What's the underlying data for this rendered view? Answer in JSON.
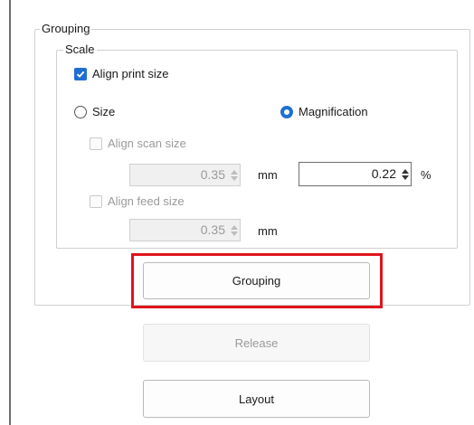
{
  "grouping_group": {
    "legend": "Grouping"
  },
  "scale_group": {
    "legend": "Scale"
  },
  "align_print_size": {
    "label": "Align print size",
    "checked": true
  },
  "radio_size": {
    "label": "Size",
    "selected": false
  },
  "radio_magnification": {
    "label": "Magnification",
    "selected": true
  },
  "align_scan_size": {
    "label": "Align scan size",
    "checked": false,
    "enabled": false
  },
  "scan_size_value": "0.35",
  "scan_size_unit": "mm",
  "magnification_value": "0.22",
  "magnification_unit": "%",
  "align_feed_size": {
    "label": "Align feed size",
    "checked": false,
    "enabled": false
  },
  "feed_size_value": "0.35",
  "feed_size_unit": "mm",
  "buttons": {
    "grouping": "Grouping",
    "release": "Release",
    "layout": "Layout"
  },
  "colors": {
    "accent": "#1f6fd1",
    "highlight": "#e0141c"
  }
}
